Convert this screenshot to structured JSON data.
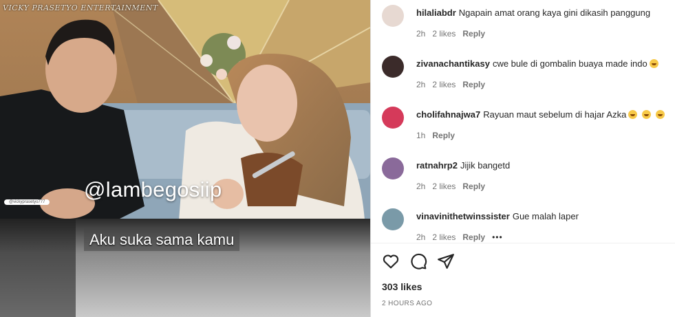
{
  "media": {
    "watermark": "VICKY PRASETYO ENTERTAINMENT",
    "small_tag": "@vickyprasetyo777",
    "handle": "@lambegosiip",
    "caption": "Aku suka sama kamu"
  },
  "comments": [
    {
      "user": "hilaliabdr",
      "text": "Ngapain amat orang kaya gini dikasih panggung",
      "emojis": 0,
      "time": "2h",
      "likes": "2 likes",
      "reply": "Reply",
      "avatar_color": "#e7d9d2"
    },
    {
      "user": "zivanachantikasy",
      "text": "cwe bule di gombalin buaya made indo",
      "emojis": 1,
      "time": "2h",
      "likes": "2 likes",
      "reply": "Reply",
      "avatar_color": "#3b2b2a"
    },
    {
      "user": "cholifahnajwa7",
      "text": "Rayuan maut sebelum di hajar Azka",
      "emojis": 3,
      "time": "1h",
      "likes": "",
      "reply": "Reply",
      "avatar_color": "#d53a5a"
    },
    {
      "user": "ratnahrp2",
      "text": "Jijik bangetd",
      "emojis": 0,
      "time": "2h",
      "likes": "2 likes",
      "reply": "Reply",
      "avatar_color": "#8a6a9a"
    },
    {
      "user": "vinavinithetwinssister",
      "text": "Gue malah laper",
      "emojis": 0,
      "time": "2h",
      "likes": "2 likes",
      "reply": "Reply",
      "more": "•••",
      "avatar_color": "#7a9aa8"
    }
  ],
  "actions": {
    "like": "heart-icon",
    "comment": "comment-icon",
    "share": "share-icon"
  },
  "likes_text": "303 likes",
  "time_ago": "2 HOURS AGO"
}
